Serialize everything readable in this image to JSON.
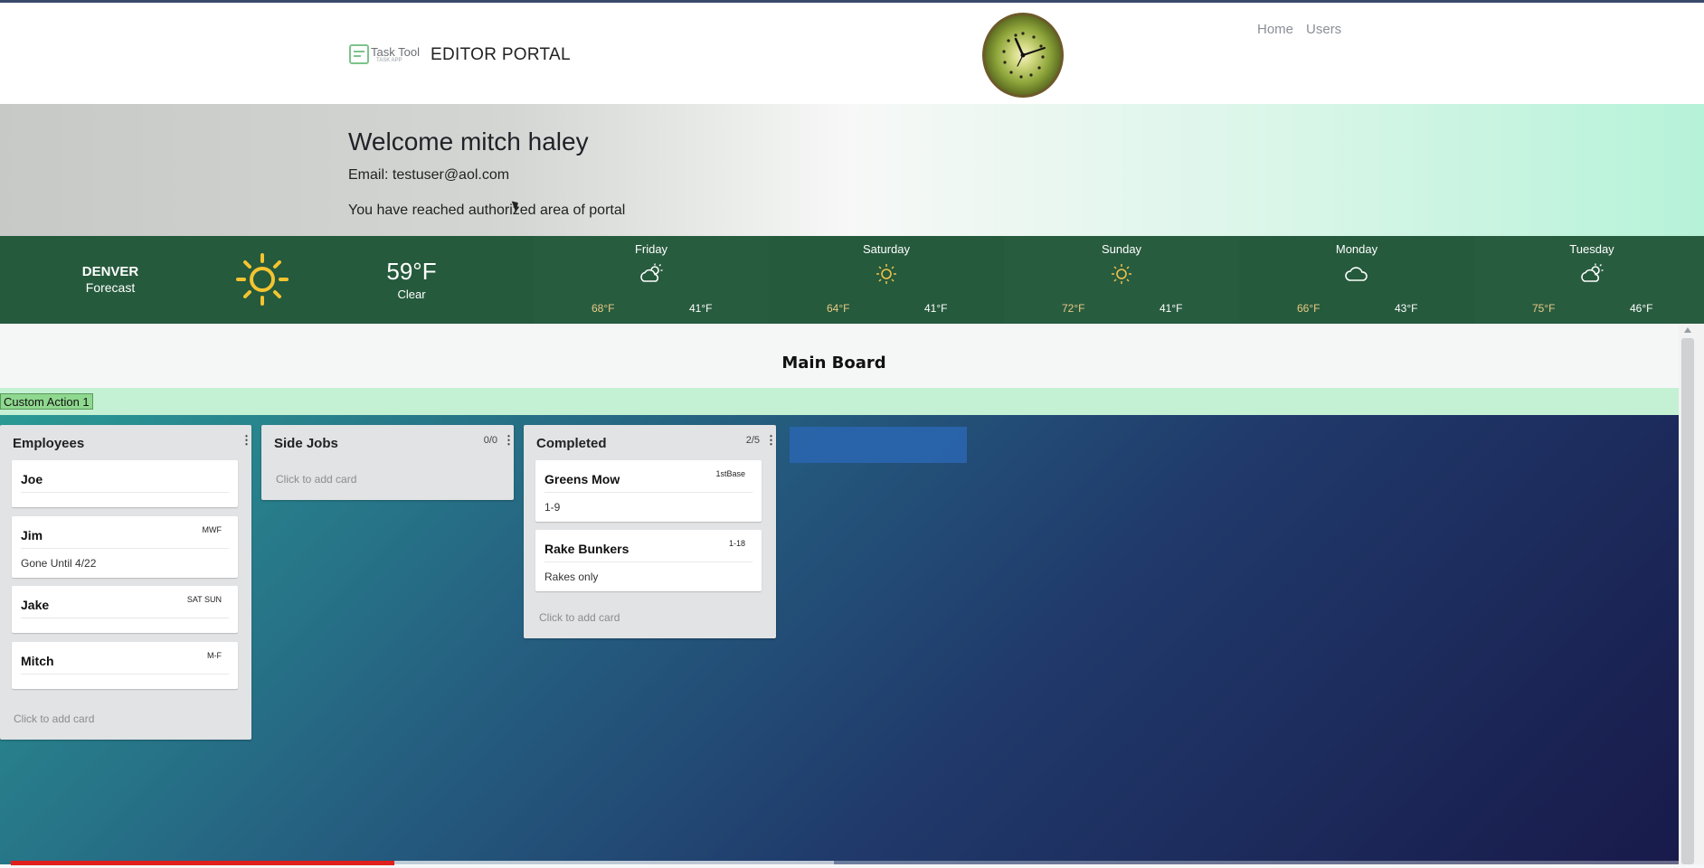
{
  "header": {
    "logo_text": "Task Tool",
    "logo_subtext": "TASK APP",
    "portal_title": "EDITOR PORTAL",
    "nav": [
      "Home",
      "Users"
    ]
  },
  "welcome": {
    "heading": "Welcome mitch haley",
    "email": "Email: testuser@aol.com",
    "message": "You have reached authorized area of portal"
  },
  "weather": {
    "city": "DENVER",
    "forecast_label": "Forecast",
    "current_temp": "59°F",
    "current_condition": "Clear",
    "current_icon": "sun-icon",
    "days": [
      {
        "name": "Friday",
        "icon": "partly-cloudy-icon",
        "high": "68°F",
        "low": "41°F"
      },
      {
        "name": "Saturday",
        "icon": "sun-icon",
        "high": "64°F",
        "low": "41°F"
      },
      {
        "name": "Sunday",
        "icon": "sun-icon",
        "high": "72°F",
        "low": "41°F"
      },
      {
        "name": "Monday",
        "icon": "cloud-icon",
        "high": "66°F",
        "low": "43°F"
      },
      {
        "name": "Tuesday",
        "icon": "partly-cloudy-icon",
        "high": "75°F",
        "low": "46°F"
      }
    ]
  },
  "board": {
    "title": "Main Board",
    "custom_action": "Custom Action 1",
    "lanes": [
      {
        "title": "Employees",
        "count": "",
        "add_card": "Click to add card",
        "cards": [
          {
            "title": "Joe",
            "tag": "",
            "description": ""
          },
          {
            "title": "Jim",
            "tag": "MWF",
            "description": "Gone Until 4/22"
          },
          {
            "title": "Jake",
            "tag": "SAT SUN",
            "description": ""
          },
          {
            "title": "Mitch",
            "tag": "M-F",
            "description": ""
          }
        ]
      },
      {
        "title": "Side Jobs",
        "count": "0/0",
        "add_card": "Click to add card",
        "cards": []
      },
      {
        "title": "Completed",
        "count": "2/5",
        "add_card": "Click to add card",
        "cards": [
          {
            "title": "Greens Mow",
            "tag": "1stBase",
            "description": "1-9"
          },
          {
            "title": "Rake Bunkers",
            "tag": "1-18",
            "description": "Rakes only"
          }
        ]
      }
    ]
  },
  "video_progress": 0.23,
  "colors": {
    "weather_bg": "#255a3c",
    "board_gradient_start": "#2a9a95",
    "board_gradient_end": "#181a4a",
    "action_bar": "#c4f1d4",
    "action_button": "#8fd88f",
    "temp_high": "#e9c985"
  }
}
